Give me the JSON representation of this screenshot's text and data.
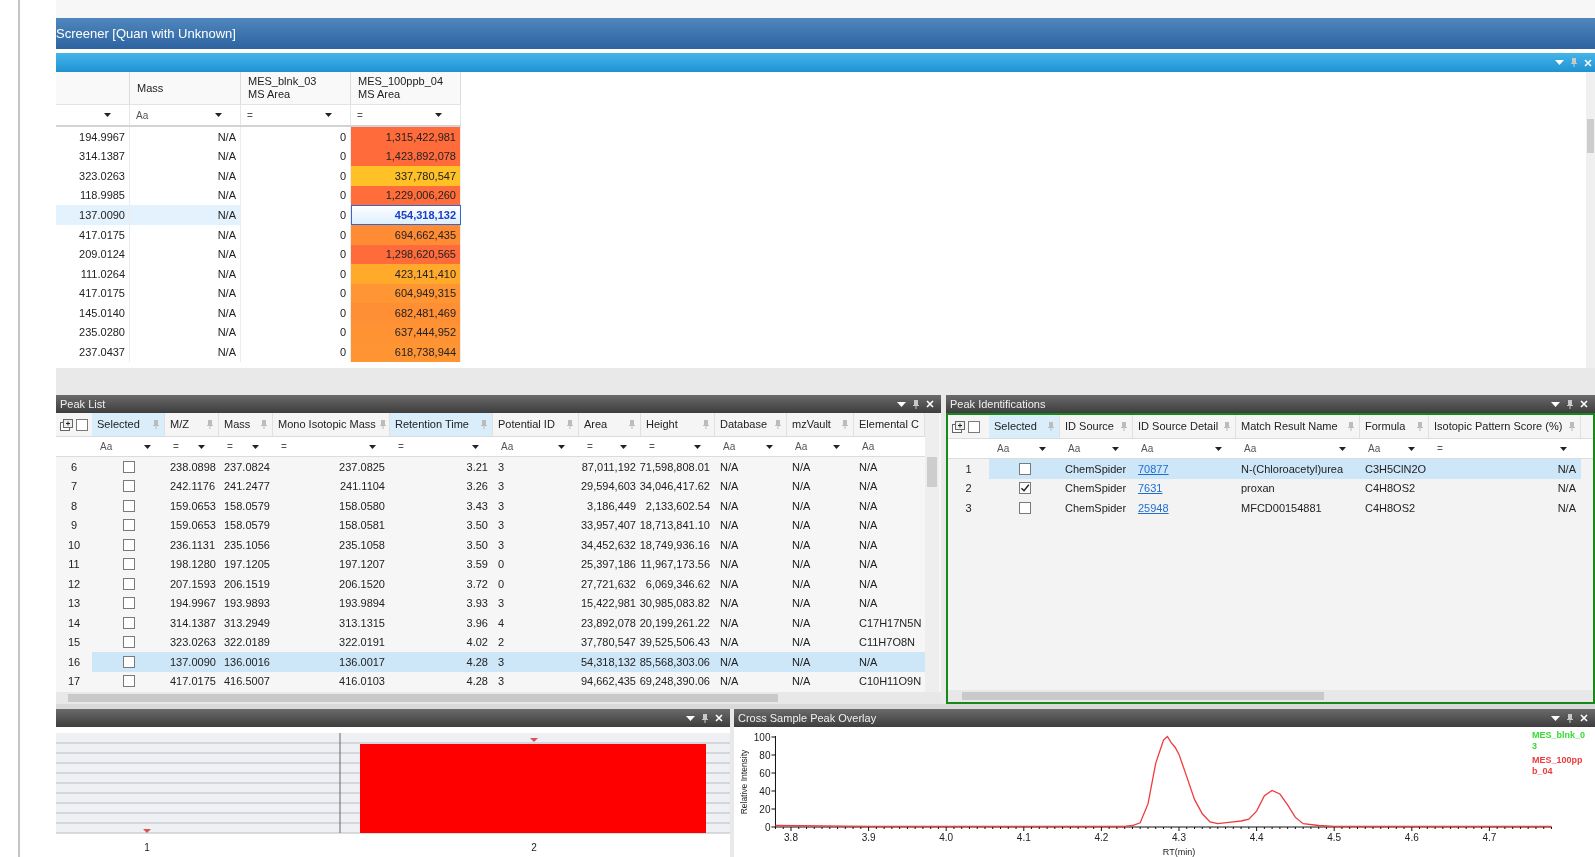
{
  "window": {
    "title": "Screener [Quan with Unknown]"
  },
  "top_table": {
    "columns": [
      {
        "dropdown": true
      },
      {
        "label": "Mass",
        "filter": "Aa",
        "dropdown": true
      },
      {
        "label": "MES_blnk_03\nMS Area",
        "filter": "=",
        "dropdown": true
      },
      {
        "label": "MES_100ppb_04\nMS Area",
        "filter": "=",
        "dropdown": true
      }
    ],
    "rows": [
      {
        "cells": [
          "194.9967",
          "N/A",
          "0",
          "1,315,422,981"
        ],
        "color": "#ff6b3b",
        "selected": false
      },
      {
        "cells": [
          "314.1387",
          "N/A",
          "0",
          "1,423,892,078"
        ],
        "color": "#ff6b3b",
        "selected": false
      },
      {
        "cells": [
          "323.0263",
          "N/A",
          "0",
          "337,780,547"
        ],
        "color": "#ffc125",
        "selected": false
      },
      {
        "cells": [
          "118.9985",
          "N/A",
          "0",
          "1,229,006,260"
        ],
        "color": "#ff6e3a",
        "selected": false
      },
      {
        "cells": [
          "137.0090",
          "N/A",
          "0",
          "454,318,132"
        ],
        "selected": true
      },
      {
        "cells": [
          "417.0175",
          "N/A",
          "0",
          "694,662,435"
        ],
        "color": "#ff8c35",
        "selected": false
      },
      {
        "cells": [
          "209.0124",
          "N/A",
          "0",
          "1,298,620,565"
        ],
        "color": "#ff6b3b",
        "selected": false
      },
      {
        "cells": [
          "111.0264",
          "N/A",
          "0",
          "423,141,410"
        ],
        "color": "#ffaa2a",
        "selected": false
      },
      {
        "cells": [
          "417.0175",
          "N/A",
          "0",
          "604,949,315"
        ],
        "color": "#ff9633",
        "selected": false
      },
      {
        "cells": [
          "145.0140",
          "N/A",
          "0",
          "682,481,469"
        ],
        "color": "#ff8f35",
        "selected": false
      },
      {
        "cells": [
          "235.0280",
          "N/A",
          "0",
          "637,444,952"
        ],
        "color": "#ff9233",
        "selected": false
      },
      {
        "cells": [
          "237.0437",
          "N/A",
          "0",
          "618,738,944"
        ],
        "color": "#ff9433",
        "selected": false
      }
    ]
  },
  "peak_list": {
    "title": "Peak List",
    "select_all_checked": false,
    "selected_column": {
      "label": "Selected",
      "filter": "Aa",
      "dropdown": true,
      "highlighted": true
    },
    "columns": [
      {
        "kind": "text",
        "label": "M/Z",
        "filter": "=",
        "dropdown": true,
        "highlighted": false
      },
      {
        "kind": "text",
        "label": "Mass",
        "filter": "=",
        "dropdown": true,
        "highlighted": false
      },
      {
        "kind": "number",
        "label": "Mono Isotopic Mass",
        "filter": "=",
        "dropdown": true,
        "highlighted": false
      },
      {
        "kind": "number",
        "label": "Retention Time",
        "filter": "=",
        "dropdown": true,
        "highlighted": true
      },
      {
        "kind": "text",
        "label": "Potential ID",
        "filter": "Aa",
        "dropdown": true,
        "highlighted": false
      },
      {
        "kind": "number",
        "label": "Area",
        "filter": "=",
        "dropdown": true,
        "highlighted": false
      },
      {
        "kind": "number",
        "label": "Height",
        "filter": "=",
        "dropdown": true,
        "highlighted": false
      },
      {
        "kind": "text",
        "label": "Database",
        "filter": "Aa",
        "dropdown": true,
        "highlighted": false
      },
      {
        "kind": "text",
        "label": "mzVault",
        "filter": "Aa",
        "dropdown": true,
        "highlighted": false
      },
      {
        "kind": "text",
        "label": "Elemental C",
        "filter": "Aa",
        "dropdown": false,
        "highlighted": false
      }
    ],
    "rows": [
      {
        "index": "6",
        "checked": false,
        "selected": false,
        "cells": [
          "238.0898",
          "237.0824",
          "237.0825",
          "3.21",
          "3",
          "87,011,192",
          "71,598,808.01",
          "N/A",
          "N/A",
          "N/A"
        ]
      },
      {
        "index": "7",
        "checked": false,
        "selected": false,
        "cells": [
          "242.1176",
          "241.2477",
          "241.1104",
          "3.26",
          "3",
          "29,594,603",
          "34,046,417.62",
          "N/A",
          "N/A",
          "N/A"
        ]
      },
      {
        "index": "8",
        "checked": false,
        "selected": false,
        "cells": [
          "159.0653",
          "158.0579",
          "158.0580",
          "3.43",
          "3",
          "3,186,449",
          "2,133,602.54",
          "N/A",
          "N/A",
          "N/A"
        ]
      },
      {
        "index": "9",
        "checked": false,
        "selected": false,
        "cells": [
          "159.0653",
          "158.0579",
          "158.0581",
          "3.50",
          "3",
          "33,957,407",
          "18,713,841.10",
          "N/A",
          "N/A",
          "N/A"
        ]
      },
      {
        "index": "10",
        "checked": false,
        "selected": false,
        "cells": [
          "236.1131",
          "235.1056",
          "235.1058",
          "3.50",
          "3",
          "34,452,632",
          "18,749,936.16",
          "N/A",
          "N/A",
          "N/A"
        ]
      },
      {
        "index": "11",
        "checked": false,
        "selected": false,
        "cells": [
          "198.1280",
          "197.1205",
          "197.1207",
          "3.59",
          "0",
          "25,397,186",
          "11,967,173.56",
          "N/A",
          "N/A",
          "N/A"
        ]
      },
      {
        "index": "12",
        "checked": false,
        "selected": false,
        "cells": [
          "207.1593",
          "206.1519",
          "206.1520",
          "3.72",
          "0",
          "27,721,632",
          "6,069,346.62",
          "N/A",
          "N/A",
          "N/A"
        ]
      },
      {
        "index": "13",
        "checked": false,
        "selected": false,
        "cells": [
          "194.9967",
          "193.9893",
          "193.9894",
          "3.93",
          "3",
          "15,422,981",
          "30,985,083.82",
          "N/A",
          "N/A",
          "N/A"
        ]
      },
      {
        "index": "14",
        "checked": false,
        "selected": false,
        "cells": [
          "314.1387",
          "313.2949",
          "313.1315",
          "3.96",
          "4",
          "23,892,078",
          "20,199,261.22",
          "N/A",
          "N/A",
          "C17H17N5N"
        ]
      },
      {
        "index": "15",
        "checked": false,
        "selected": false,
        "cells": [
          "323.0263",
          "322.0189",
          "322.0191",
          "4.02",
          "2",
          "37,780,547",
          "39,525,506.43",
          "N/A",
          "N/A",
          "C11H7O8N"
        ]
      },
      {
        "index": "16",
        "checked": false,
        "selected": true,
        "cells": [
          "137.0090",
          "136.0016",
          "136.0017",
          "4.28",
          "3",
          "54,318,132",
          "85,568,303.06",
          "N/A",
          "N/A",
          "N/A"
        ]
      },
      {
        "index": "17",
        "checked": false,
        "selected": false,
        "cells": [
          "417.0175",
          "416.5007",
          "416.0103",
          "4.28",
          "3",
          "94,662,435",
          "69,248,390.06",
          "N/A",
          "N/A",
          "C10H11O9N"
        ]
      }
    ]
  },
  "peak_identifications": {
    "title": "Peak Identifications",
    "select_all_checked": false,
    "selected_column": {
      "label": "Selected",
      "filter": "Aa",
      "dropdown": true,
      "highlighted": true
    },
    "columns": [
      {
        "kind": "text",
        "label": "ID Source",
        "filter": "Aa",
        "dropdown": true,
        "highlighted": false
      },
      {
        "kind": "link",
        "label": "ID Source Detail",
        "filter": "Aa",
        "dropdown": true,
        "highlighted": false
      },
      {
        "kind": "text",
        "label": "Match Result Name",
        "filter": "Aa",
        "dropdown": true,
        "highlighted": false
      },
      {
        "kind": "text",
        "label": "Formula",
        "filter": "Aa",
        "dropdown": true,
        "highlighted": false
      },
      {
        "kind": "number",
        "label": "Isotopic Pattern Score (%)",
        "filter": "=",
        "dropdown": true,
        "highlighted": false
      }
    ],
    "rows": [
      {
        "index": "1",
        "checked": false,
        "selected": true,
        "cells": [
          "ChemSpider",
          "70877",
          "N-(Chloroacetyl)urea",
          "C3H5ClN2O",
          "N/A"
        ]
      },
      {
        "index": "2",
        "checked": true,
        "selected": false,
        "cells": [
          "ChemSpider",
          "7631",
          "proxan",
          "C4H8OS2",
          "N/A"
        ]
      },
      {
        "index": "3",
        "checked": false,
        "selected": false,
        "cells": [
          "ChemSpider",
          "25948",
          "MFCD00154881",
          "C4H8OS2",
          "N/A"
        ]
      }
    ]
  },
  "bar_panel": {
    "bar_labels": [
      "1",
      "2"
    ]
  },
  "overlay": {
    "title": "Cross Sample Peak Overlay",
    "legend": [
      {
        "label": "MES_blnk_03",
        "color": "#33dd33"
      },
      {
        "label": "MES_100ppb_04",
        "color": "#ee3b3b"
      }
    ],
    "chart_data": {
      "type": "line",
      "xlabel": "RT(min)",
      "ylabel": "Relative Intensity",
      "x": [
        3.78,
        3.9,
        4.0,
        4.1,
        4.2,
        4.23,
        4.24,
        4.25,
        4.26,
        4.27,
        4.28,
        4.285,
        4.29,
        4.295,
        4.3,
        4.31,
        4.32,
        4.33,
        4.34,
        4.35,
        4.37,
        4.38,
        4.39,
        4.4,
        4.41,
        4.42,
        4.43,
        4.44,
        4.45,
        4.46,
        4.48,
        4.5,
        4.6,
        4.7,
        4.78
      ],
      "series": [
        {
          "color": "#ee3b3b",
          "values": [
            1,
            0,
            0,
            0,
            0,
            0,
            1,
            4,
            25,
            70,
            96,
            100,
            93,
            88,
            80,
            55,
            30,
            14,
            5,
            3,
            5,
            6,
            8,
            17,
            34,
            40,
            36,
            24,
            10,
            3,
            1,
            0,
            0,
            0,
            0
          ]
        }
      ],
      "xlim": [
        3.78,
        4.78
      ],
      "ylim": [
        0,
        100
      ],
      "xticks": [
        {
          "value": 3.8,
          "label": "3.8"
        },
        {
          "value": 3.9,
          "label": "3.9"
        },
        {
          "value": 4,
          "label": "4.0"
        },
        {
          "value": 4.1,
          "label": "4.1"
        },
        {
          "value": 4.2,
          "label": "4.2"
        },
        {
          "value": 4.3,
          "label": "4.3"
        },
        {
          "value": 4.4,
          "label": "4.4"
        },
        {
          "value": 4.5,
          "label": "4.5"
        },
        {
          "value": 4.6,
          "label": "4.6"
        },
        {
          "value": 4.7,
          "label": "4.7"
        }
      ],
      "yticks": [
        0,
        20,
        40,
        60,
        80,
        100
      ]
    }
  }
}
